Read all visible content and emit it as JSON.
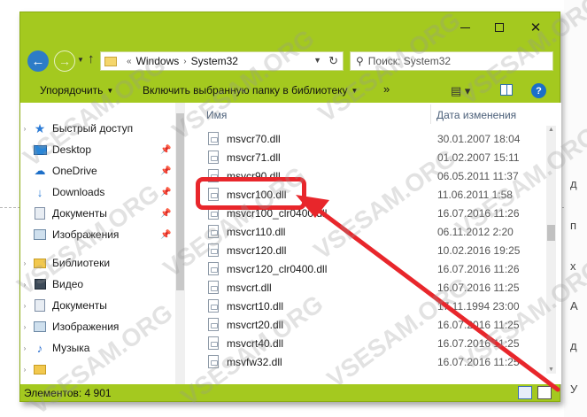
{
  "background": {
    "edge_chars": [
      "д",
      "п",
      "х",
      "А",
      "д",
      "У"
    ]
  },
  "window": {
    "titlebar": {
      "minimize_icon": "minimize-icon",
      "maximize_icon": "maximize-icon",
      "close_glyph": "✕"
    },
    "address_bar": {
      "prefix": "«",
      "crumbs": [
        "Windows",
        "System32"
      ],
      "separator": "›"
    },
    "search": {
      "placeholder": "Поиск: System32"
    },
    "toolbar": {
      "organize_label": "Упорядочить",
      "include_label": "Включить выбранную папку в библиотеку",
      "more_label": "»"
    },
    "nav_pane": {
      "items": [
        {
          "label": "Быстрый доступ",
          "icon": "star-icon",
          "pinned": false
        },
        {
          "label": "Desktop",
          "icon": "desktop-icon",
          "pinned": true
        },
        {
          "label": "OneDrive",
          "icon": "cloud-icon",
          "pinned": true
        },
        {
          "label": "Downloads",
          "icon": "download-icon",
          "pinned": true
        },
        {
          "label": "Документы",
          "icon": "documents-icon",
          "pinned": true
        },
        {
          "label": "Изображения",
          "icon": "pictures-icon",
          "pinned": true
        },
        {
          "label": "Библиотеки",
          "icon": "libraries-icon",
          "pinned": false
        },
        {
          "label": "Видео",
          "icon": "video-icon",
          "pinned": false
        },
        {
          "label": "Документы",
          "icon": "documents-icon",
          "pinned": false
        },
        {
          "label": "Изображения",
          "icon": "pictures-icon",
          "pinned": false
        },
        {
          "label": "Музыка",
          "icon": "music-icon",
          "pinned": false
        },
        {
          "label": "",
          "icon": "folder-icon",
          "pinned": false
        }
      ]
    },
    "file_list": {
      "columns": {
        "name": "Имя",
        "date": "Дата изменения"
      },
      "rows": [
        {
          "name": "msvcr70.dll",
          "date": "30.01.2007 18:04"
        },
        {
          "name": "msvcr71.dll",
          "date": "01.02.2007 15:11"
        },
        {
          "name": "msvcr90.dll",
          "date": "06.05.2011 11:37"
        },
        {
          "name": "msvcr100.dll",
          "date": "11.06.2011 1:58"
        },
        {
          "name": "msvcr100_clr0400.dll",
          "date": "16.07.2016 11:26"
        },
        {
          "name": "msvcr110.dll",
          "date": "06.11.2012 2:20"
        },
        {
          "name": "msvcr120.dll",
          "date": "10.02.2016 19:25"
        },
        {
          "name": "msvcr120_clr0400.dll",
          "date": "16.07.2016 11:26"
        },
        {
          "name": "msvcrt.dll",
          "date": "16.07.2016 11:25"
        },
        {
          "name": "msvcrt10.dll",
          "date": "17.11.1994 23:00"
        },
        {
          "name": "msvcrt20.dll",
          "date": "16.07.2016 11:25"
        },
        {
          "name": "msvcrt40.dll",
          "date": "16.07.2016 11:25"
        },
        {
          "name": "msvfw32.dll",
          "date": "16.07.2016 11:25"
        }
      ]
    },
    "status": {
      "count_label": "Элементов: 4 901"
    }
  },
  "annotation": {
    "highlight_color": "#e8262b",
    "highlighted_file": "msvcr100.dll"
  },
  "watermark": {
    "text": "VSESAM.ORG"
  }
}
